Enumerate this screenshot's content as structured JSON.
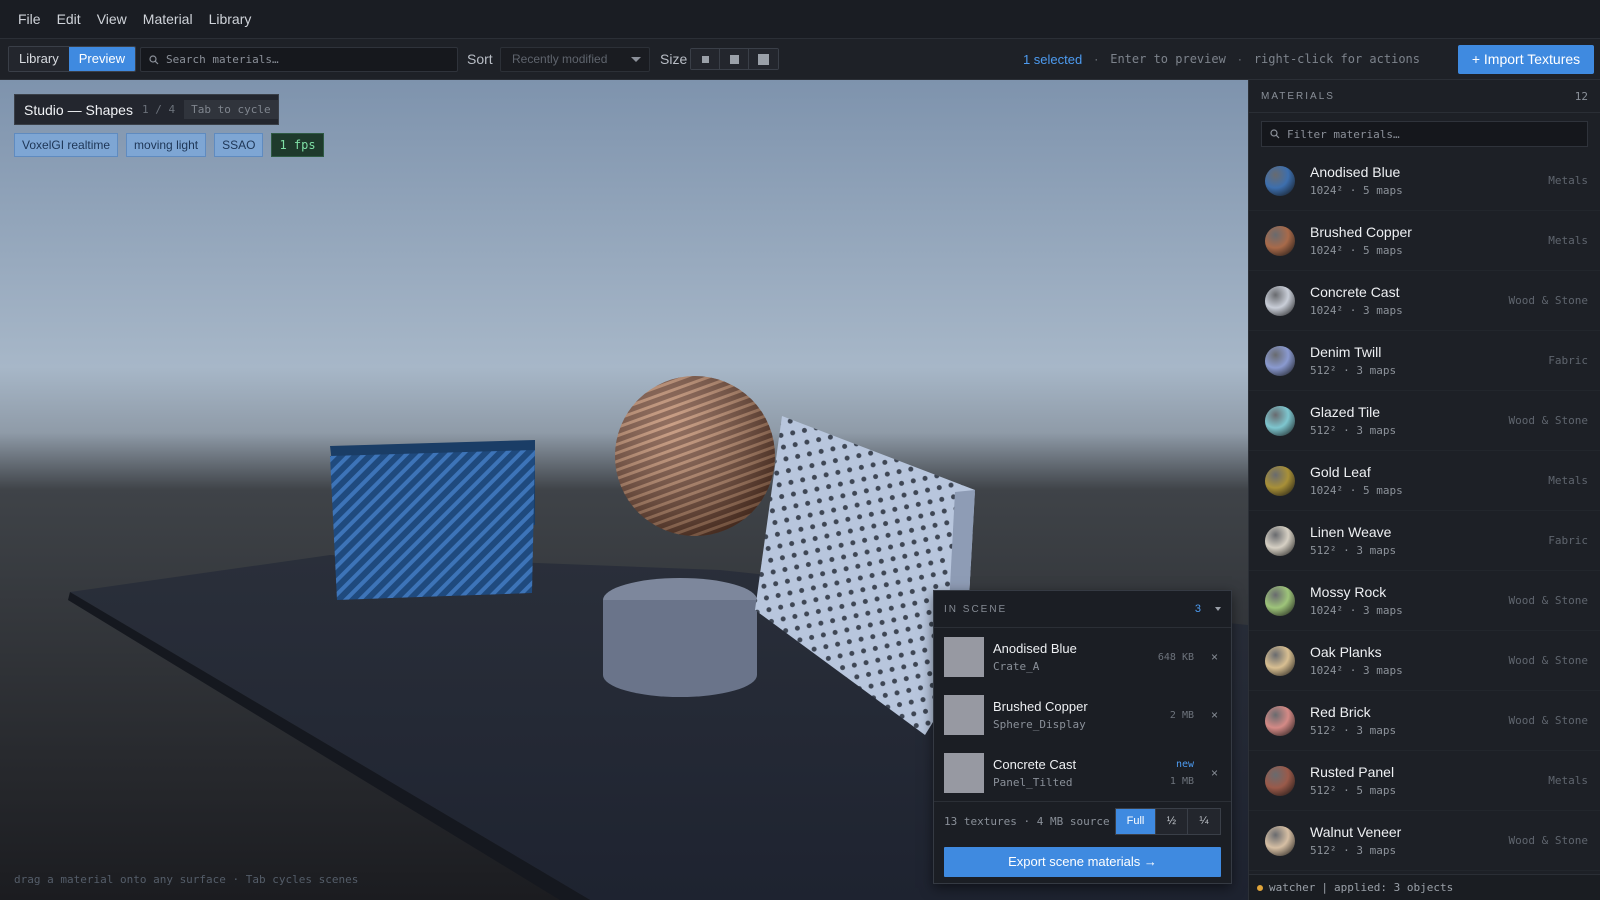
{
  "menu": [
    "File",
    "Edit",
    "View",
    "Material",
    "Library"
  ],
  "toolbar": {
    "tabs": [
      {
        "label": "Library",
        "active": false
      },
      {
        "label": "Preview",
        "active": true
      }
    ],
    "search_placeholder": "Search materials…",
    "sort_label": "Sort",
    "sort_value": "Recently modified",
    "size_label": "Size",
    "selected": "1 selected",
    "hint_preview": "Enter to preview",
    "hint_actions": "right-click for actions",
    "import_label": "Import Textures"
  },
  "viewport": {
    "scene_title": "Studio — Shapes",
    "scene_index": "1 / 4",
    "cycle_hint": "Tab to cycle",
    "chips": [
      "VoxelGI realtime",
      "moving light",
      "SSAO"
    ],
    "fps": "1 fps",
    "footer_hint": "drag a material onto any surface  ·  Tab cycles scenes"
  },
  "in_scene": {
    "title": "IN SCENE",
    "count": "3",
    "items": [
      {
        "name": "Anodised Blue",
        "object": "Crate_A",
        "size": "648 KB",
        "badge": ""
      },
      {
        "name": "Brushed Copper",
        "object": "Sphere_Display",
        "size": "2 MB",
        "badge": ""
      },
      {
        "name": "Concrete Cast",
        "object": "Panel_Tilted",
        "size": "1 MB",
        "badge": "new"
      }
    ],
    "summary": "13 textures · 4 MB source",
    "resolution": [
      "Full",
      "½",
      "¼"
    ],
    "export_label": "Export scene materials →"
  },
  "sidebar": {
    "title": "MATERIALS",
    "count": "12",
    "filter_placeholder": "Filter materials…",
    "materials": [
      {
        "name": "Anodised Blue",
        "meta": "1024²  ·  5 maps",
        "category": "Metals",
        "color": "#3d6fae"
      },
      {
        "name": "Brushed Copper",
        "meta": "1024²  ·  5 maps",
        "category": "Metals",
        "color": "#a86a4a"
      },
      {
        "name": "Concrete Cast",
        "meta": "1024²  ·  3 maps",
        "category": "Wood & Stone",
        "color": "#c9ced8"
      },
      {
        "name": "Denim Twill",
        "meta": "512²  ·  3 maps",
        "category": "Fabric",
        "color": "#8a9ad0"
      },
      {
        "name": "Glazed Tile",
        "meta": "512²  ·  3 maps",
        "category": "Wood & Stone",
        "color": "#7ec6cf"
      },
      {
        "name": "Gold Leaf",
        "meta": "1024²  ·  5 maps",
        "category": "Metals",
        "color": "#a89038"
      },
      {
        "name": "Linen Weave",
        "meta": "512²  ·  3 maps",
        "category": "Fabric",
        "color": "#d6d0c4"
      },
      {
        "name": "Mossy Rock",
        "meta": "1024²  ·  3 maps",
        "category": "Wood & Stone",
        "color": "#9ec47a"
      },
      {
        "name": "Oak Planks",
        "meta": "1024²  ·  3 maps",
        "category": "Wood & Stone",
        "color": "#d8bf92"
      },
      {
        "name": "Red Brick",
        "meta": "512²  ·  3 maps",
        "category": "Wood & Stone",
        "color": "#d48a86"
      },
      {
        "name": "Rusted Panel",
        "meta": "512²  ·  5 maps",
        "category": "Metals",
        "color": "#9a5a4a"
      },
      {
        "name": "Walnut Veneer",
        "meta": "512²  ·  3 maps",
        "category": "Wood & Stone",
        "color": "#d6bfa4"
      }
    ],
    "footer_watcher": "watcher",
    "footer_status": "applied: 3 objects"
  },
  "colors": {
    "accent": "#3f8ae0",
    "fps": "#7fe0a6",
    "watcher": "#e0a43a"
  }
}
